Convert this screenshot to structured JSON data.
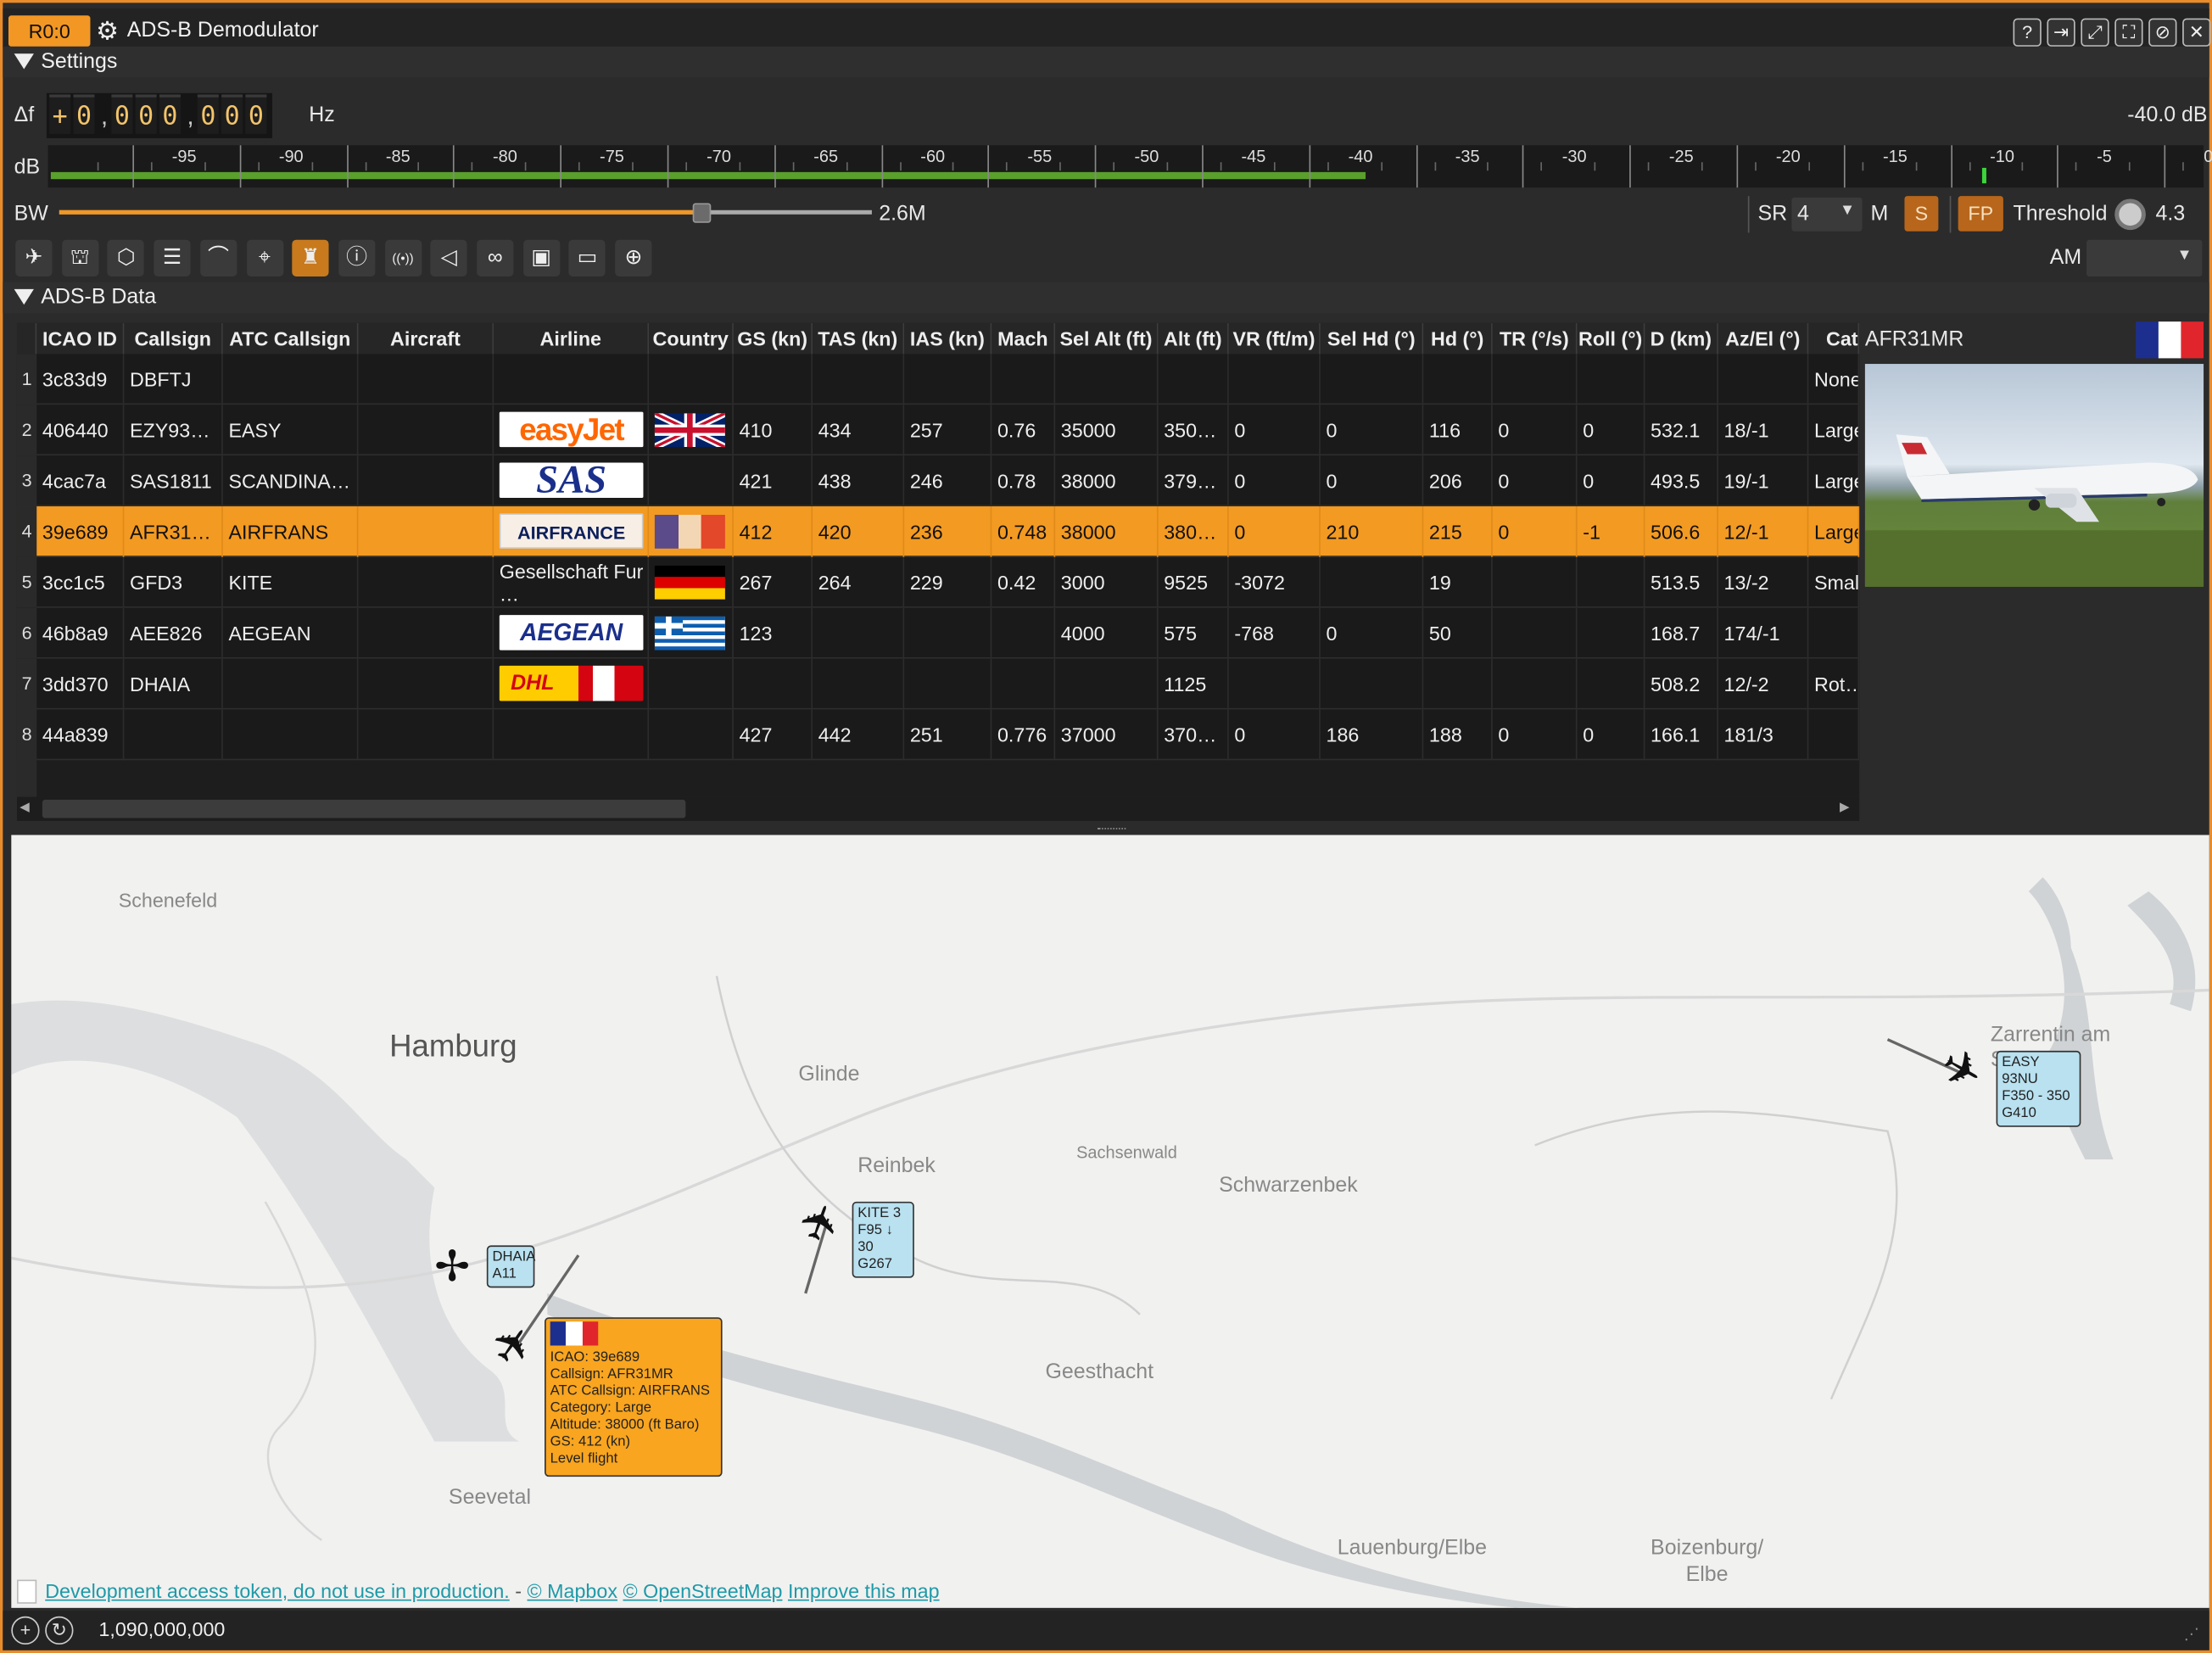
{
  "title_bar": {
    "rx_badge": "R0:0",
    "title": "ADS-B Demodulator",
    "buttons": [
      "help-icon",
      "move-to-workspace-icon",
      "maximize-icon",
      "fullscreen-icon",
      "hide-icon",
      "close-icon"
    ]
  },
  "settings": {
    "header": "Settings",
    "delta_f_label": "Δf",
    "delta_f_digits": [
      "+",
      "0",
      ",",
      "0",
      "0",
      "0",
      ",",
      "0",
      "0",
      "0"
    ],
    "hz_label": "Hz",
    "db_readout": "-40.0 dB",
    "db_label": "dB",
    "db_ticks": [
      "-95",
      "-90",
      "-85",
      "-80",
      "-75",
      "-70",
      "-65",
      "-60",
      "-55",
      "-50",
      "-45",
      "-40",
      "-35",
      "-30",
      "-25",
      "-20",
      "-15",
      "-10",
      "-5",
      "0"
    ],
    "db_level_fraction": 0.61,
    "db_peak_fraction": 0.897,
    "bw_label": "BW",
    "bw_value": "2.6M",
    "bw_fraction": 0.79,
    "sr_label": "SR",
    "sr_value": "4",
    "m_label": "M",
    "s_button": "S",
    "fp_button": "FP",
    "threshold_label": "Threshold",
    "threshold_value": "4.3",
    "am_label": "AM",
    "am_value": "",
    "toolbar_icons": [
      "airplane-icon",
      "airport-icon",
      "hexagon-icon",
      "list-icon",
      "curve-icon",
      "antenna-map-icon",
      "control-tower-icon",
      "info-icon",
      "broadcast-icon",
      "speaker-icon",
      "tape-icon",
      "save-icon",
      "open-folder-icon",
      "crosshair-icon"
    ]
  },
  "adsb_data": {
    "header": "ADS-B Data",
    "columns": [
      "ICAO ID",
      "Callsign",
      "ATC Callsign",
      "Aircraft",
      "Airline",
      "Country",
      "GS (kn)",
      "TAS (kn)",
      "IAS (kn)",
      "Mach",
      "Sel Alt (ft)",
      "Alt (ft)",
      "VR (ft/m)",
      "Sel Hd (°)",
      "Hd (°)",
      "TR (°/s)",
      "Roll (°)",
      "D (km)",
      "Az/El (°)",
      "Cat"
    ],
    "rows": [
      {
        "num": "1",
        "icao": "3c83d9",
        "callsign": "DBFTJ",
        "atc": "",
        "aircraft": "",
        "airline": "",
        "country": "",
        "gs": "",
        "tas": "",
        "ias": "",
        "mach": "",
        "selalt": "",
        "alt": "",
        "vr": "",
        "selhd": "",
        "hd": "",
        "tr": "",
        "roll": "",
        "d": "",
        "azel": "",
        "cat": "None"
      },
      {
        "num": "2",
        "icao": "406440",
        "callsign": "EZY93…",
        "atc": "EASY",
        "aircraft": "",
        "airline": "easyJet",
        "country": "uk",
        "gs": "410",
        "tas": "434",
        "ias": "257",
        "mach": "0.76",
        "selalt": "35000",
        "alt": "350…",
        "vr": "0",
        "selhd": "0",
        "hd": "116",
        "tr": "0",
        "roll": "0",
        "d": "532.1",
        "azel": "18/-1",
        "cat": "Large"
      },
      {
        "num": "3",
        "icao": "4cac7a",
        "callsign": "SAS1811",
        "atc": "SCANDINA…",
        "aircraft": "",
        "airline": "SAS",
        "country": "",
        "gs": "421",
        "tas": "438",
        "ias": "246",
        "mach": "0.78",
        "selalt": "38000",
        "alt": "379…",
        "vr": "0",
        "selhd": "0",
        "hd": "206",
        "tr": "0",
        "roll": "0",
        "d": "493.5",
        "azel": "19/-1",
        "cat": "Large"
      },
      {
        "num": "4",
        "icao": "39e689",
        "callsign": "AFR31…",
        "atc": "AIRFRANS",
        "aircraft": "",
        "airline": "AIRFRANCE",
        "country": "fr",
        "gs": "412",
        "tas": "420",
        "ias": "236",
        "mach": "0.748",
        "selalt": "38000",
        "alt": "380…",
        "vr": "0",
        "selhd": "210",
        "hd": "215",
        "tr": "0",
        "roll": "-1",
        "d": "506.6",
        "azel": "12/-1",
        "cat": "Large"
      },
      {
        "num": "5",
        "icao": "3cc1c5",
        "callsign": "GFD3",
        "atc": "KITE",
        "aircraft": "",
        "airline_text": "Gesellschaft Fur …",
        "airline": "",
        "country": "de",
        "gs": "267",
        "tas": "264",
        "ias": "229",
        "mach": "0.42",
        "selalt": "3000",
        "alt": "9525",
        "vr": "-3072",
        "selhd": "",
        "hd": "19",
        "tr": "",
        "roll": "",
        "d": "513.5",
        "azel": "13/-2",
        "cat": "Smal"
      },
      {
        "num": "6",
        "icao": "46b8a9",
        "callsign": "AEE826",
        "atc": "AEGEAN",
        "aircraft": "",
        "airline": "AEGEAN",
        "country": "gr",
        "gs": "123",
        "tas": "",
        "ias": "",
        "mach": "",
        "selalt": "4000",
        "alt": "575",
        "vr": "-768",
        "selhd": "0",
        "hd": "50",
        "tr": "",
        "roll": "",
        "d": "168.7",
        "azel": "174/-1",
        "cat": ""
      },
      {
        "num": "7",
        "icao": "3dd370",
        "callsign": "DHAIA",
        "atc": "",
        "aircraft": "",
        "airline": "DHL",
        "country": "",
        "gs": "",
        "tas": "",
        "ias": "",
        "mach": "",
        "selalt": "",
        "alt": "1125",
        "vr": "",
        "selhd": "",
        "hd": "",
        "tr": "",
        "roll": "",
        "d": "508.2",
        "azel": "12/-2",
        "cat": "Rot…"
      },
      {
        "num": "8",
        "icao": "44a839",
        "callsign": "",
        "atc": "",
        "aircraft": "",
        "airline": "",
        "country": "",
        "gs": "427",
        "tas": "442",
        "ias": "251",
        "mach": "0.776",
        "selalt": "37000",
        "alt": "370…",
        "vr": "0",
        "selhd": "186",
        "hd": "188",
        "tr": "0",
        "roll": "0",
        "d": "166.1",
        "azel": "181/3",
        "cat": ""
      }
    ],
    "side_panel": {
      "callsign": "AFR31MR"
    }
  },
  "map": {
    "labels": [
      "Schenefeld",
      "Hamburg",
      "Glinde",
      "Reinbek",
      "Sachsenwald",
      "Schwarzenbek",
      "Geesthacht",
      "Seevetal",
      "Zarrentin am See",
      "Lauenburg/Elbe",
      "Boizenburg/ Elbe"
    ],
    "callouts": {
      "dhaia": [
        "DHAIA",
        "A11"
      ],
      "kite": [
        "KITE 3",
        "F95 ↓ 30",
        "G267"
      ],
      "easy": [
        "EASY 93NU",
        "F350 - 350",
        "G410"
      ]
    },
    "popup": [
      "ICAO: 39e689",
      "Callsign: AFR31MR",
      "ATC Callsign: AIRFRANS",
      "Category: Large",
      "Altitude: 38000 (ft Baro)",
      "GS: 412 (kn)",
      "Level flight"
    ],
    "attribution": {
      "token": "Development access token, do not use in production.",
      "dash": "-",
      "mapbox": "© Mapbox",
      "osm": "© OpenStreetMap",
      "improve": "Improve this map"
    }
  },
  "status_bar": {
    "frequency": "1,090,000,000"
  }
}
